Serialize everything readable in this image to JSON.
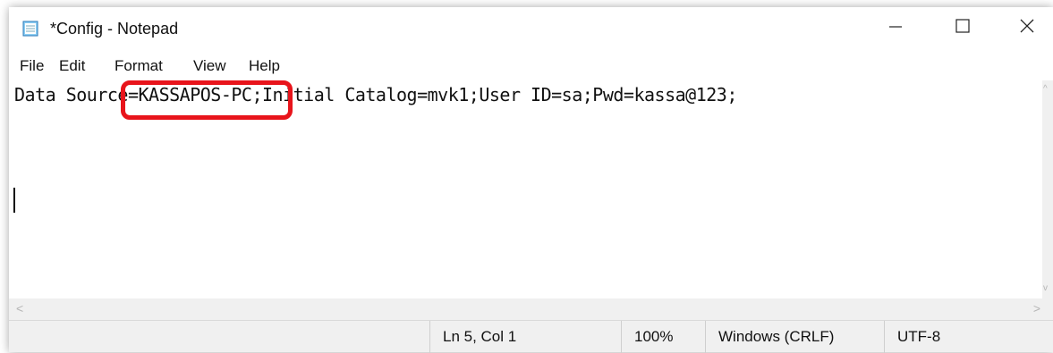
{
  "window": {
    "title": "*Config - Notepad",
    "controls": {
      "minimize": "—",
      "maximize": "☐",
      "close": "✕"
    }
  },
  "menu": {
    "items": [
      "File",
      "Edit",
      "Format",
      "View",
      "Help"
    ]
  },
  "editor": {
    "content_line_1": "Data Source=KASSAPOS-PC;Initial Catalog=mvk1;User ID=sa;Pwd=kassa@123;"
  },
  "highlight": {
    "color": "#e8141b",
    "note_text": ""
  },
  "statusbar": {
    "position": "Ln 5, Col 1",
    "zoom": "100%",
    "line_endings": "Windows (CRLF)",
    "encoding": "UTF-8"
  },
  "icons": {
    "app": "notepad-icon",
    "minimize": "minimize-icon",
    "maximize": "maximize-icon",
    "close": "close-icon"
  }
}
